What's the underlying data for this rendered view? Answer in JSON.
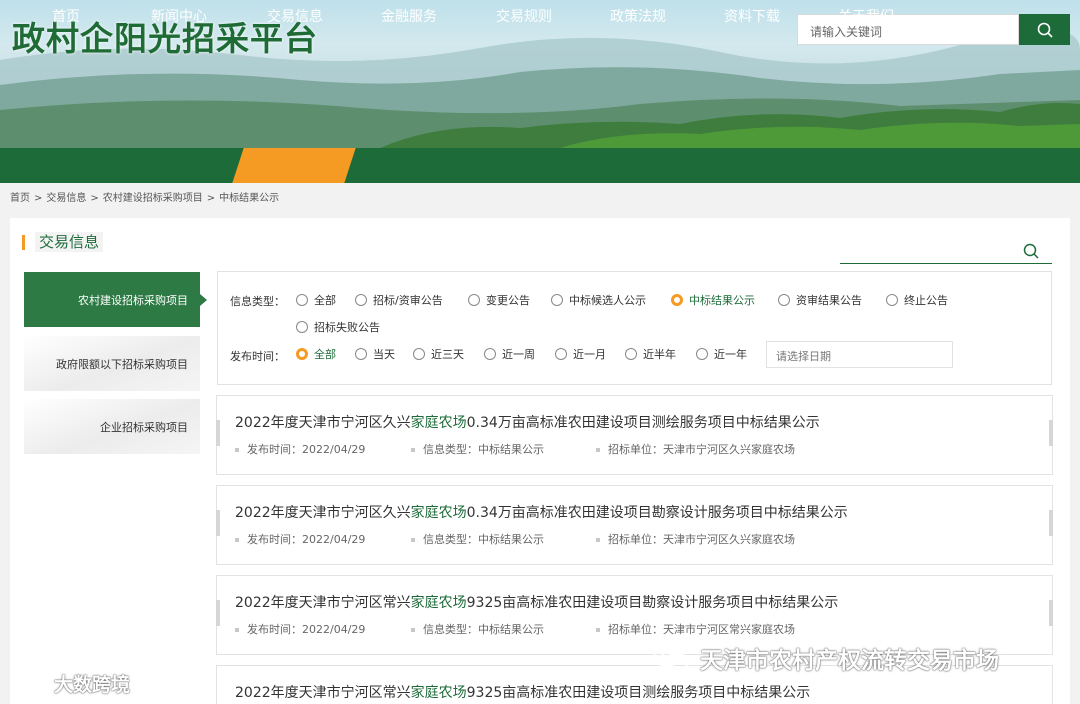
{
  "header": {
    "site_title": "政村企阳光招采平台",
    "search_placeholder": "请输入关键词"
  },
  "nav": {
    "items": [
      "首页",
      "新闻中心",
      "交易信息",
      "金融服务",
      "交易规则",
      "政策法规",
      "资料下载",
      "关于我们"
    ],
    "active_index": 2
  },
  "breadcrumb": [
    "首页",
    "交易信息",
    "农村建设招标采购项目",
    "中标结果公示"
  ],
  "section": {
    "title": "交易信息"
  },
  "sidebar": {
    "items": [
      "农村建设招标采购项目",
      "政府限额以下招标采购项目",
      "企业招标采购项目"
    ],
    "active_index": 0
  },
  "filters": {
    "type_label": "信息类型：",
    "type_options": [
      "全部",
      "招标/资审公告",
      "变更公告",
      "中标候选人公示",
      "中标结果公示",
      "资审结果公告",
      "终止公告",
      "招标失败公告"
    ],
    "type_selected": "中标结果公示",
    "time_label": "发布时间：",
    "time_options": [
      "全部",
      "当天",
      "近三天",
      "近一周",
      "近一月",
      "近半年",
      "近一年"
    ],
    "time_selected": "全部",
    "date_placeholder": "请选择日期"
  },
  "results": [
    {
      "title_prefix": "2022年度天津市宁河区久兴",
      "title_highlight": "家庭农场",
      "title_suffix": "0.34万亩高标准农田建设项目测绘服务项目中标结果公示",
      "date": "发布时间：2022/04/29",
      "type": "信息类型：中标结果公示",
      "unit": "招标单位：天津市宁河区久兴家庭农场"
    },
    {
      "title_prefix": "2022年度天津市宁河区久兴",
      "title_highlight": "家庭农场",
      "title_suffix": "0.34万亩高标准农田建设项目勘察设计服务项目中标结果公示",
      "date": "发布时间：2022/04/29",
      "type": "信息类型：中标结果公示",
      "unit": "招标单位：天津市宁河区久兴家庭农场"
    },
    {
      "title_prefix": "2022年度天津市宁河区常兴",
      "title_highlight": "家庭农场",
      "title_suffix": "9325亩高标准农田建设项目勘察设计服务项目中标结果公示",
      "date": "发布时间：2022/04/29",
      "type": "信息类型：中标结果公示",
      "unit": "招标单位：天津市宁河区常兴家庭农场"
    },
    {
      "title_prefix": "2022年度天津市宁河区常兴",
      "title_highlight": "家庭农场",
      "title_suffix": "9325亩高标准农田建设项目测绘服务项目中标结果公示"
    }
  ],
  "watermarks": {
    "wechat": "天津市农村产权流转交易市场",
    "platform": "大数跨境"
  },
  "colors": {
    "brand_green": "#1e6b3a",
    "accent_orange": "#f59a23"
  },
  "icons": [
    "search-icon",
    "wechat-icon",
    "platform-logo-icon"
  ]
}
